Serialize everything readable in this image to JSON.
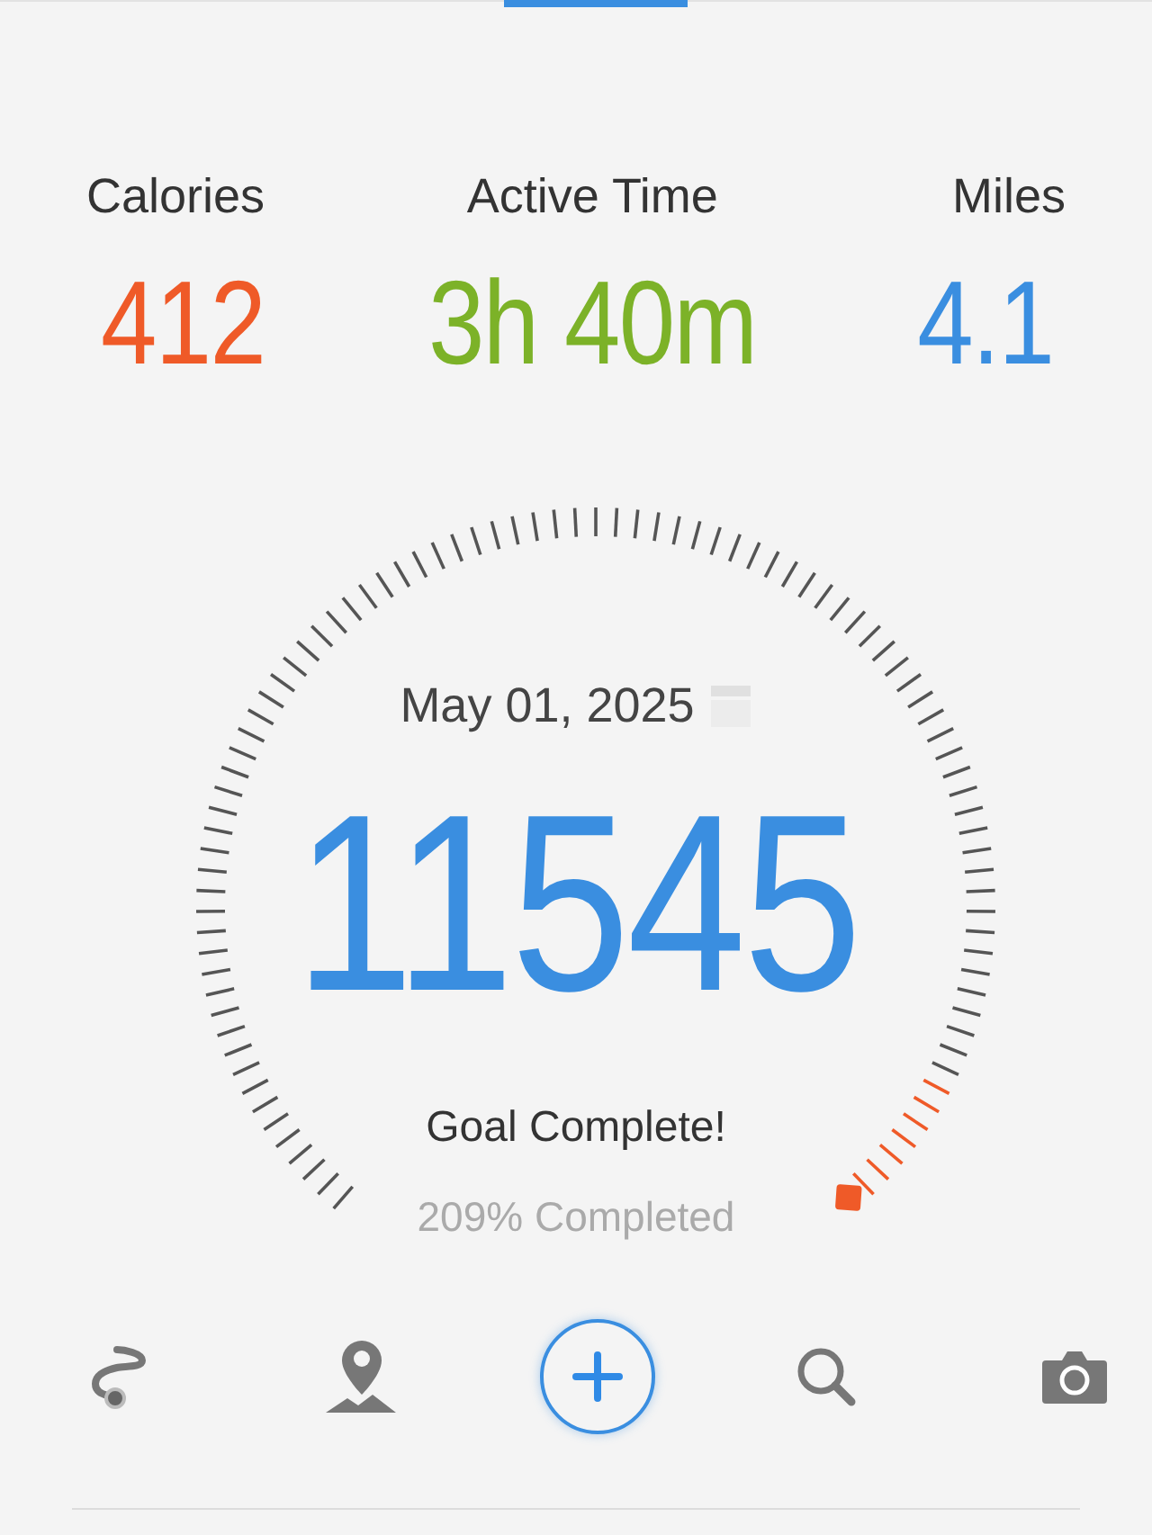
{
  "stats": [
    {
      "label": "Calories",
      "value": "412",
      "color": "#ef5a28"
    },
    {
      "label": "Active Time",
      "value": "3h 40m",
      "color": "#7cb228"
    },
    {
      "label": "Miles",
      "value": "4.1",
      "color": "#3a8ee0"
    }
  ],
  "gauge": {
    "date": "May 01, 2025",
    "steps": "11545",
    "goal_text": "Goal Complete!",
    "percent_text": "209% Completed"
  },
  "toolbar": [
    {
      "kind": "route"
    },
    {
      "kind": "map"
    },
    {
      "kind": "add"
    },
    {
      "kind": "search"
    },
    {
      "kind": "camera"
    }
  ]
}
